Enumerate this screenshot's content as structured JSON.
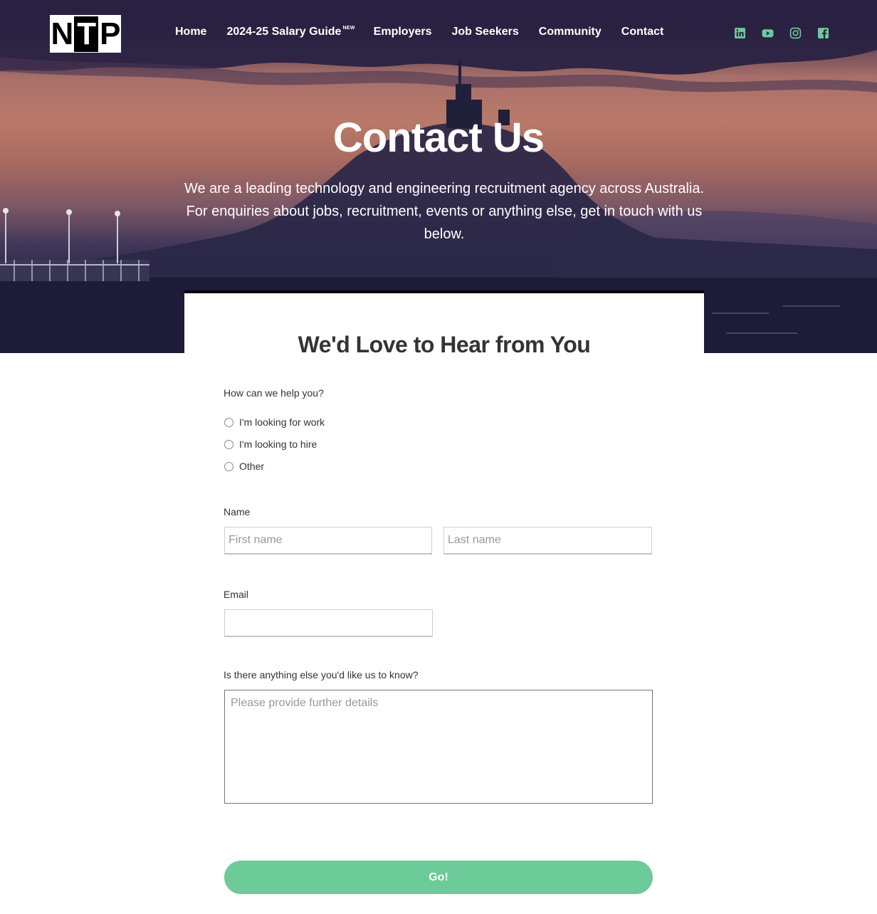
{
  "brand": {
    "logo_letters": [
      "N",
      "T",
      "P"
    ]
  },
  "nav": {
    "items": [
      {
        "label": "Home"
      },
      {
        "label": "2024-25 Salary Guide",
        "badge": "NEW"
      },
      {
        "label": "Employers"
      },
      {
        "label": "Job Seekers"
      },
      {
        "label": "Community"
      },
      {
        "label": "Contact"
      }
    ]
  },
  "social": {
    "icons": [
      "linkedin-icon",
      "youtube-icon",
      "instagram-icon",
      "facebook-icon"
    ],
    "color": "#6ccb98"
  },
  "hero": {
    "title": "Contact Us",
    "description": "We are a leading technology and engineering recruitment agency across Australia. For enquiries about jobs, recruitment, events or anything else, get in touch with us below."
  },
  "form": {
    "title": "We'd Love to Hear from You",
    "help_question": "How can we help you?",
    "options": [
      "I'm looking for work",
      "I'm looking to hire",
      "Other"
    ],
    "name_label": "Name",
    "first_name_placeholder": "First name",
    "last_name_placeholder": "Last name",
    "email_label": "Email",
    "email_value": "",
    "details_label": "Is there anything else you'd like us to know?",
    "details_placeholder": "Please provide further details",
    "submit_label": "Go!",
    "accent_color": "#6ccb98"
  }
}
